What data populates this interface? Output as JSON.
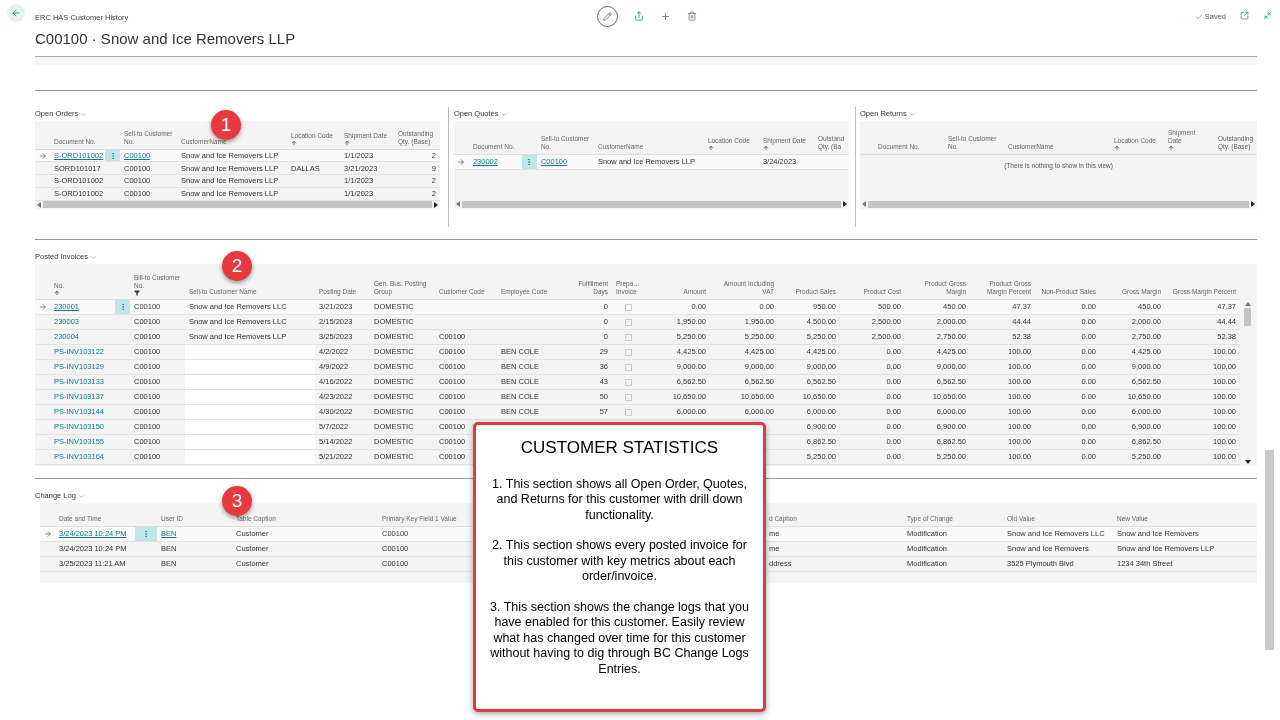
{
  "header": {
    "breadcrumb": "ERC HAS Customer History",
    "title": "C00100 · Snow and Ice Removers LLP",
    "status": "Saved"
  },
  "open_orders": {
    "title": "Open Orders",
    "badge": "1",
    "columns": [
      {
        "label": "Document No."
      },
      {
        "label": "Sell-to Customer No."
      },
      {
        "label": "CustomerName"
      },
      {
        "label": "Location Code",
        "sorted": true
      },
      {
        "label": "Shipment Date",
        "sorted": true
      },
      {
        "label": "Outstanding Qty. (Base)"
      }
    ],
    "rows": [
      {
        "selected": true,
        "cells": [
          "S-ORD101002",
          "C00100",
          "Snow and Ice Removers LLP",
          null,
          "1/1/2023",
          "2"
        ]
      },
      {
        "selected": false,
        "cells": [
          "SORD101017",
          "C00100",
          "Snow and Ice Removers LLP",
          "DALLAS",
          "3/21/2023",
          "9"
        ]
      },
      {
        "selected": false,
        "cells": [
          "S-ORD101002",
          "C00100",
          "Snow and Ice Removers LLP",
          null,
          "1/1/2023",
          "2"
        ]
      },
      {
        "selected": false,
        "cells": [
          "S-ORD101002",
          "C00100",
          "Snow and Ice Removers LLP",
          null,
          "1/1/2023",
          "2"
        ]
      }
    ]
  },
  "open_quotes": {
    "title": "Open Quotes",
    "columns": [
      {
        "label": "Document No."
      },
      {
        "label": "Sell-to Customer No."
      },
      {
        "label": "CustomerName"
      },
      {
        "label": "Location Code",
        "sorted": true
      },
      {
        "label": "Shipment Date",
        "sorted": true
      },
      {
        "label": "Outstand Qty. (Ba"
      }
    ],
    "rows": [
      {
        "selected": true,
        "cells": [
          "230002",
          "C00100",
          "Snow and Ice Removers LLP",
          null,
          "3/24/2023",
          null
        ]
      }
    ]
  },
  "open_returns": {
    "title": "Open Returns",
    "columns": [
      {
        "label": "Document No."
      },
      {
        "label": "Sell-to Customer No."
      },
      {
        "label": "CustomerName"
      },
      {
        "label": "Location Code",
        "sorted": true
      },
      {
        "label": "Shipment Date",
        "sorted": true
      },
      {
        "label": "Outstanding Qty. (Base)"
      }
    ],
    "empty_message": "(There is nothing to show in this view)"
  },
  "posted_invoices": {
    "title": "Posted Invoices",
    "badge": "2",
    "columns": [
      {
        "label": "No.",
        "sorted": true
      },
      {
        "label": "Bill-to Customer No.",
        "filtered": true
      },
      {
        "label": "Sell-to Customer Name"
      },
      {
        "label": "Posting Date"
      },
      {
        "label": "Gen. Bus. Posting Group"
      },
      {
        "label": "Customer Code"
      },
      {
        "label": "Employee Code"
      },
      {
        "label": "Fulfillment Days"
      },
      {
        "label": "Prepa… Invoice"
      },
      {
        "label": "Amount"
      },
      {
        "label": "Amount Including VAT"
      },
      {
        "label": "Product Sales"
      },
      {
        "label": "Product Cost"
      },
      {
        "label": "Product Gross Margin"
      },
      {
        "label": "Product Gross Margin Percent"
      },
      {
        "label": "Non-Product Sales"
      },
      {
        "label": "Gross Margin"
      },
      {
        "label": "Gross Margin Percent"
      }
    ],
    "rows": [
      {
        "selected": true,
        "redacted": false,
        "cells": [
          "230001",
          "C00100",
          "Snow and Ice Removers LLC",
          "3/21/2023",
          "DOMESTIC",
          null,
          null,
          "0",
          false,
          "0.00",
          "0.00",
          "950.00",
          "500.00",
          "450.00",
          "47.37",
          "0.00",
          "450.00",
          "47.37"
        ]
      },
      {
        "selected": false,
        "redacted": false,
        "cells": [
          "230003",
          "C00100",
          "Snow and Ice Removers LLC",
          "2/15/2023",
          "DOMESTIC",
          null,
          null,
          "0",
          false,
          "1,950.00",
          "1,950.00",
          "4,500.00",
          "2,500.00",
          "2,000.00",
          "44.44",
          "0.00",
          "2,000.00",
          "44.44"
        ]
      },
      {
        "selected": false,
        "redacted": false,
        "cells": [
          "230004",
          "C00100",
          "Snow and Ice Removers LLP",
          "3/25/2023",
          "DOMESTIC",
          "C00100",
          null,
          "0",
          false,
          "5,250.00",
          "5,250.00",
          "5,250.00",
          "2,500.00",
          "2,750.00",
          "52.38",
          "0.00",
          "2,750.00",
          "52.38"
        ]
      },
      {
        "selected": false,
        "redacted": true,
        "cells": [
          "PS-INV103122",
          "C00100",
          null,
          "4/2/2022",
          "DOMESTIC",
          "C00100",
          "BEN COLE",
          "29",
          false,
          "4,425.00",
          "4,425.00",
          "4,425.00",
          "0.00",
          "4,425.00",
          "100.00",
          "0.00",
          "4,425.00",
          "100.00"
        ]
      },
      {
        "selected": false,
        "redacted": true,
        "cells": [
          "PS-INV103129",
          "C00100",
          null,
          "4/9/2022",
          "DOMESTIC",
          "C00100",
          "BEN COLE",
          "36",
          false,
          "9,000.00",
          "9,000.00",
          "9,000.00",
          "0.00",
          "9,000.00",
          "100.00",
          "0.00",
          "9,000.00",
          "100.00"
        ]
      },
      {
        "selected": false,
        "redacted": true,
        "cells": [
          "PS-INV103133",
          "C00100",
          null,
          "4/16/2022",
          "DOMESTIC",
          "C00100",
          "BEN COLE",
          "43",
          false,
          "6,562.50",
          "6,562.50",
          "6,562.50",
          "0.00",
          "6,562.50",
          "100.00",
          "0.00",
          "6,562.50",
          "100.00"
        ]
      },
      {
        "selected": false,
        "redacted": true,
        "cells": [
          "PS-INV103137",
          "C00100",
          null,
          "4/23/2022",
          "DOMESTIC",
          "C00100",
          "BEN COLE",
          "50",
          false,
          "10,650.00",
          "10,650.00",
          "10,650.00",
          "0.00",
          "10,650.00",
          "100.00",
          "0.00",
          "10,650.00",
          "100.00"
        ]
      },
      {
        "selected": false,
        "redacted": true,
        "cells": [
          "PS-INV103144",
          "C00100",
          null,
          "4/30/2022",
          "DOMESTIC",
          "C00100",
          "BEN COLE",
          "57",
          false,
          "6,000.00",
          "6,000.00",
          "6,000.00",
          "0.00",
          "6,000.00",
          "100.00",
          "0.00",
          "6,000.00",
          "100.00"
        ]
      },
      {
        "selected": false,
        "redacted": true,
        "cells": [
          "PS-INV103150",
          "C00100",
          null,
          "5/7/2022",
          "DOMESTIC",
          "C00100",
          null,
          null,
          null,
          null,
          null,
          "6,900.00",
          "0.00",
          "6,900.00",
          "100.00",
          "0.00",
          "6,900.00",
          "100.00"
        ]
      },
      {
        "selected": false,
        "redacted": true,
        "cells": [
          "PS-INV103155",
          "C00100",
          null,
          "5/14/2022",
          "DOMESTIC",
          "C00100",
          null,
          null,
          null,
          null,
          null,
          "6,862.50",
          "0.00",
          "6,862.50",
          "100.00",
          "0.00",
          "6,862.50",
          "100.00"
        ]
      },
      {
        "selected": false,
        "redacted": true,
        "cells": [
          "PS-INV103164",
          "C00100",
          null,
          "5/21/2022",
          "DOMESTIC",
          "C00100",
          null,
          null,
          null,
          null,
          null,
          "5,250.00",
          "0.00",
          "5,250.00",
          "100.00",
          "0.00",
          "5,250.00",
          "100.00"
        ]
      }
    ]
  },
  "change_log": {
    "title": "Change Log",
    "badge": "3",
    "columns": [
      {
        "label": "Date and Time"
      },
      {
        "label": "User ID"
      },
      {
        "label": "Table Caption"
      },
      {
        "label": "Primary Key Field 1 Value"
      },
      {
        "label": "d Caption"
      },
      {
        "label": "Type of Change"
      },
      {
        "label": "Old Value"
      },
      {
        "label": "New Value"
      }
    ],
    "rows": [
      {
        "selected": true,
        "cells": [
          "3/24/2023 10:24 PM",
          "BEN",
          "Customer",
          "C00100",
          "me",
          "Modification",
          "Snow and Ice Removers LLC",
          "Snow and Ice Removers"
        ]
      },
      {
        "selected": false,
        "cells": [
          "3/24/2023 10:24 PM",
          "BEN",
          "Customer",
          "C00100",
          "me",
          "Modification",
          "Snow and Ice Removers",
          "Snow and Ice Removers LLP"
        ]
      },
      {
        "selected": false,
        "cells": [
          "3/25/2023 11:21 AM",
          "BEN",
          "Customer",
          "C00100",
          "ddress",
          "Modification",
          "3525 Plymouth Blvd",
          "1234 34th Street"
        ]
      }
    ]
  },
  "callout": {
    "title": "CUSTOMER STATISTICS",
    "paragraphs": [
      "1. This section shows all Open Order, Quotes, and Returns for this customer with drill down functionality.",
      "2. This section shows every posted invoice for this customer with key metrics about each order/invoice.",
      "3. This section shows the change logs that you have enabled for this customer. Easily review what has changed over time for this customer without having to dig through BC Change Logs Entries."
    ]
  }
}
